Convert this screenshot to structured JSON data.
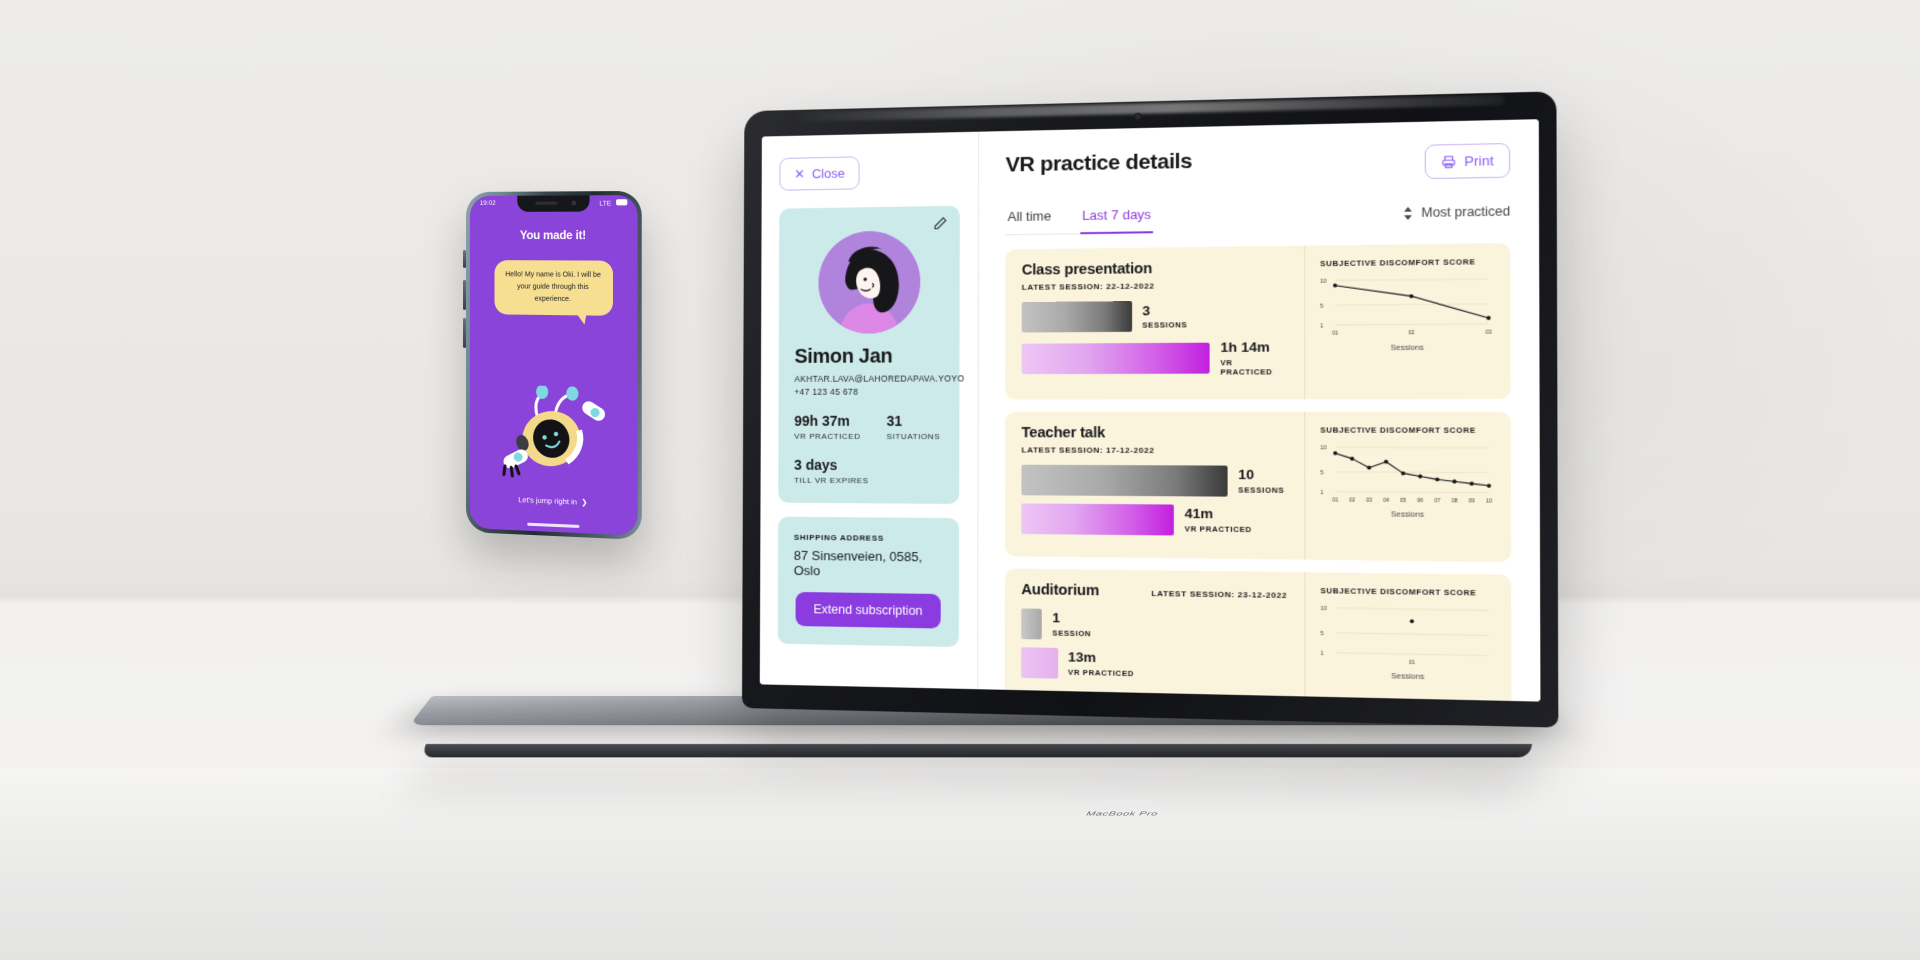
{
  "scene": {
    "device_label": "MacBook Pro"
  },
  "phone": {
    "status": {
      "time": "19:02",
      "network": "LTE",
      "battery_icon": "battery-icon"
    },
    "headline": "You made it!",
    "bubble_text": "Hello! My name is Oki. I will be your guide through this experience.",
    "mascot_name": "oki-robot-mascot",
    "cta_label": "Let's jump right in",
    "cta_icon": "chevron-right-icon",
    "bg_color": "#8b44d9",
    "bubble_color": "#f7df92"
  },
  "app": {
    "sidebar": {
      "close_label": "Close",
      "close_icon": "close-x-icon",
      "edit_icon": "pencil-edit-icon",
      "profile": {
        "avatar_alt": "user-avatar-illustration",
        "name": "Simon Jan",
        "email": "AKHTAR.LAVA@LAHOREDAPAVA.YOYO",
        "phone": "+47 123 45 678",
        "stats": [
          {
            "value": "99h 37m",
            "label": "VR PRACTICED"
          },
          {
            "value": "31",
            "label": "SITUATIONS"
          }
        ],
        "expiry": {
          "value": "3 days",
          "label": "TILL  VR EXPIRES"
        }
      },
      "shipping": {
        "label": "SHIPPING ADDRESS",
        "address": "87 Sinsenveien, 0585, Oslo",
        "button_label": "Extend subscription"
      },
      "card_color": "#cdeaea",
      "accent_color": "#8b3ce0"
    },
    "main": {
      "title": "VR practice details",
      "print_label": "Print",
      "print_icon": "printer-icon",
      "tabs": [
        {
          "label": "All time",
          "active": false
        },
        {
          "label": "Last 7 days",
          "active": true
        }
      ],
      "sort": {
        "label": "Most practiced",
        "icon": "sort-updown-icon"
      },
      "chart_axis_label": "Sessions",
      "chart_heading": "SUBJECTIVE DISCOMFORT SCORE",
      "card_bg": "#fbf4dc",
      "cards": [
        {
          "title": "Class presentation",
          "latest_session": "LATEST SESSION: 22-12-2022",
          "sessions_value": "3",
          "sessions_label": "SESSIONS",
          "practiced_value": "1h 14m",
          "practiced_label": "VR PRACTICED",
          "sessions_bar_pct": 42,
          "practiced_bar_pct": 72
        },
        {
          "title": "Teacher talk",
          "latest_session": "LATEST SESSION: 17-12-2022",
          "sessions_value": "10",
          "sessions_label": "SESSIONS",
          "practiced_value": "41m",
          "practiced_label": "VR PRACTICED",
          "sessions_bar_pct": 78,
          "practiced_bar_pct": 58
        },
        {
          "title": "Auditorium",
          "latest_session": "LATEST SESSION: 23-12-2022",
          "sessions_value": "1",
          "sessions_label": "SESSION",
          "practiced_value": "13m",
          "practiced_label": "VR PRACTICED",
          "sessions_bar_pct": 8,
          "practiced_bar_pct": 14,
          "title_inline": true
        }
      ]
    }
  },
  "chart_data": [
    {
      "type": "line",
      "title": "SUBJECTIVE DISCOMFORT SCORE",
      "for_card": "Class presentation",
      "xlabel": "Sessions",
      "ylabel": "",
      "categories": [
        "01",
        "02",
        "03"
      ],
      "x": [
        1,
        2,
        3
      ],
      "values": [
        9.0,
        6.7,
        2.2
      ],
      "yticks": [
        1,
        5,
        10
      ],
      "ylim": [
        1,
        10
      ],
      "grid": true,
      "legend": false,
      "marker": "circle",
      "color": "#17171a"
    },
    {
      "type": "line",
      "title": "SUBJECTIVE DISCOMFORT SCORE",
      "for_card": "Teacher talk",
      "xlabel": "Sessions",
      "ylabel": "",
      "categories": [
        "01",
        "02",
        "03",
        "04",
        "05",
        "06",
        "07",
        "08",
        "09",
        "10"
      ],
      "x": [
        1,
        2,
        3,
        4,
        5,
        6,
        7,
        8,
        9,
        10
      ],
      "values": [
        8.8,
        7.7,
        5.9,
        7.1,
        4.8,
        4.2,
        3.6,
        3.2,
        2.8,
        2.4
      ],
      "yticks": [
        1,
        5,
        10
      ],
      "ylim": [
        1,
        10
      ],
      "grid": true,
      "legend": false,
      "marker": "circle",
      "color": "#17171a"
    },
    {
      "type": "scatter",
      "title": "SUBJECTIVE DISCOMFORT SCORE",
      "for_card": "Auditorium",
      "xlabel": "Sessions",
      "ylabel": "",
      "categories": [
        "01"
      ],
      "x": [
        1
      ],
      "values": [
        7.6
      ],
      "yticks": [
        1,
        5,
        10
      ],
      "ylim": [
        1,
        10
      ],
      "grid": true,
      "legend": false,
      "marker": "circle",
      "color": "#17171a"
    }
  ]
}
